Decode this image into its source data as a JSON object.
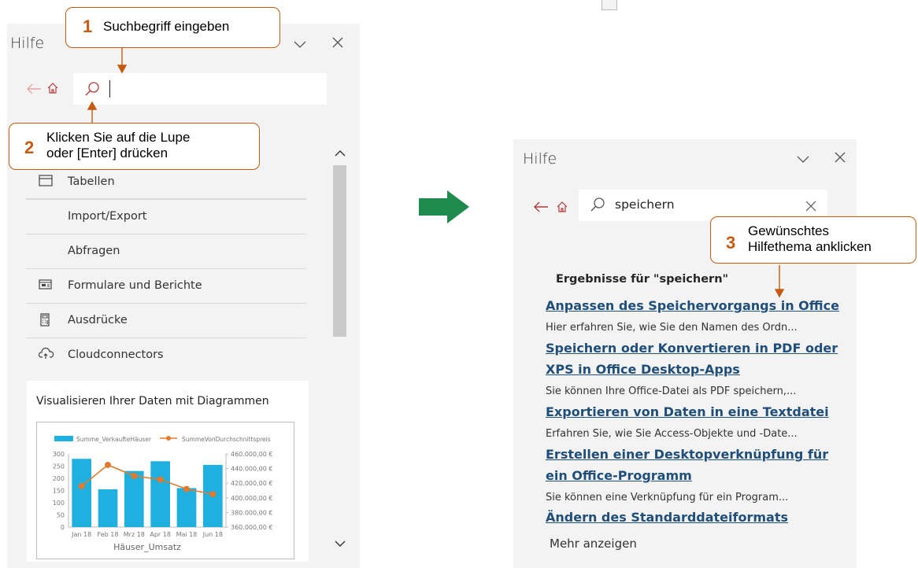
{
  "left_pane": {
    "title": "Hilfe",
    "topics": [
      {
        "label": "Tabellen",
        "icon": "table-icon"
      },
      {
        "label": "Import/Export",
        "icon": ""
      },
      {
        "label": "Abfragen",
        "icon": ""
      },
      {
        "label": "Formulare und Berichte",
        "icon": "form-icon"
      },
      {
        "label": "Ausdrücke",
        "icon": "calculator-icon"
      },
      {
        "label": "Cloudconnectors",
        "icon": "cloud-icon"
      }
    ],
    "card": {
      "title": "Visualisieren Ihrer Daten mit Diagrammen"
    }
  },
  "chart_data": {
    "type": "bar",
    "title": "Häuser_Umsatz",
    "categories": [
      "Jan 18",
      "Feb 18",
      "Mrz 18",
      "Apr 18",
      "Mai 18",
      "Jun 18"
    ],
    "series": [
      {
        "name": "Summe_VerkaufteHäuser",
        "kind": "bar",
        "axis": "left",
        "color": "#1fb0e0",
        "values": [
          280,
          155,
          230,
          270,
          160,
          255
        ]
      },
      {
        "name": "SummeVonDurchschnittspreis",
        "kind": "line",
        "axis": "right",
        "color": "#e07a2e",
        "values": [
          416000,
          445000,
          430000,
          425000,
          412000,
          405000
        ]
      }
    ],
    "y_left": {
      "min": 0,
      "max": 300,
      "ticks": [
        "0",
        "50",
        "100",
        "150",
        "200",
        "250",
        "300"
      ]
    },
    "y_right": {
      "min": 360000,
      "max": 460000,
      "ticks": [
        "360.000,00 €",
        "380.000,00 €",
        "400.000,00 €",
        "420.000,00 €",
        "440.000,00 €",
        "460.000,00 €"
      ]
    },
    "legend": "top",
    "grid": false
  },
  "right_pane": {
    "title": "Hilfe",
    "search_value": "speichern",
    "results_heading": "Ergebnisse für \"speichern\"",
    "results": [
      {
        "lines": [
          "Anpassen des Speichervorgangs in Office"
        ],
        "snippet": "Hier erfahren Sie, wie Sie den Namen des Ordn..."
      },
      {
        "lines": [
          "Speichern oder Konvertieren in PDF oder",
          "XPS in Office Desktop-Apps"
        ],
        "snippet": "Sie können Ihre Office-Datei als PDF speichern,..."
      },
      {
        "lines": [
          "Exportieren von Daten in eine Textdatei"
        ],
        "snippet": "Erfahren Sie, wie Sie Access-Objekte und -Date..."
      },
      {
        "lines": [
          "Erstellen einer Desktopverknüpfung für",
          "ein Office-Programm"
        ],
        "snippet": "Sie können eine Verknüpfung für ein Program..."
      },
      {
        "lines": [
          "Ändern des Standarddateiformats"
        ],
        "snippet": ""
      }
    ],
    "more_label": "Mehr anzeigen"
  },
  "callouts": {
    "c1": {
      "num": "1",
      "lines": [
        "Suchbegriff eingeben"
      ]
    },
    "c2": {
      "num": "2",
      "lines": [
        "Klicken Sie auf die Lupe",
        "oder [Enter] drücken"
      ]
    },
    "c3": {
      "num": "3",
      "lines": [
        "Gewünschtes",
        "Hilfethema anklicken"
      ]
    }
  },
  "colors": {
    "callout_border": "#c55a11",
    "arrow_green": "#1e8a4c",
    "link": "#1f4e79"
  }
}
